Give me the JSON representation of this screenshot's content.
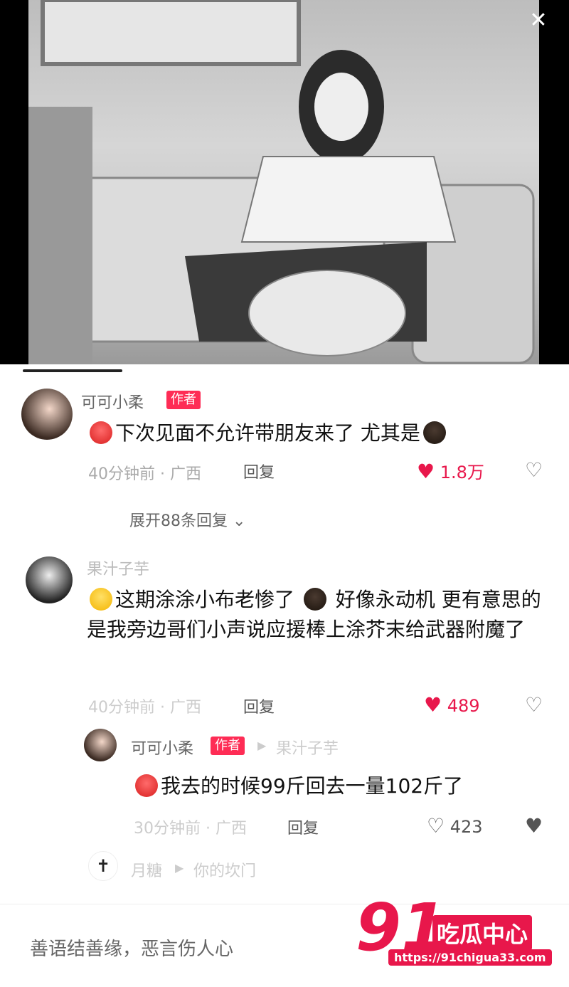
{
  "hero": {
    "close_icon": "close-icon"
  },
  "comments": [
    {
      "username": "可可小柔",
      "badge": "作者",
      "text_before": "下次见面不允许带朋友来了 尤其是",
      "meta": "40分钟前 · 广西",
      "reply_label": "回复",
      "likes": "1.8万",
      "expand_label": "展开88条回复"
    },
    {
      "username": "果汁子芋",
      "text": "这期涂涂小布老惨了 ",
      "text2": " 好像永动机 更有意思的是我旁边哥们小声说应援棒上涂芥末给武器附魔了",
      "meta": "40分钟前 · 广西",
      "reply_label": "回复",
      "likes": "489"
    },
    {
      "username": "可可小柔",
      "badge": "作者",
      "reply_to": "果汁子芋",
      "text": "我去的时候99斤回去一量102斤了",
      "meta": "30分钟前 · 广西",
      "reply_label": "回复",
      "likes": "423"
    },
    {
      "username": "月糖",
      "reply_to": "你的坎门"
    }
  ],
  "footer": {
    "input_placeholder": "善语结善缘，恶言伤人心"
  },
  "watermark": {
    "num": "91",
    "cn": "吃瓜中心",
    "url": "https://91chigua33.com"
  },
  "colors": {
    "accent": "#fe2c55",
    "brand": "#e8174b"
  }
}
